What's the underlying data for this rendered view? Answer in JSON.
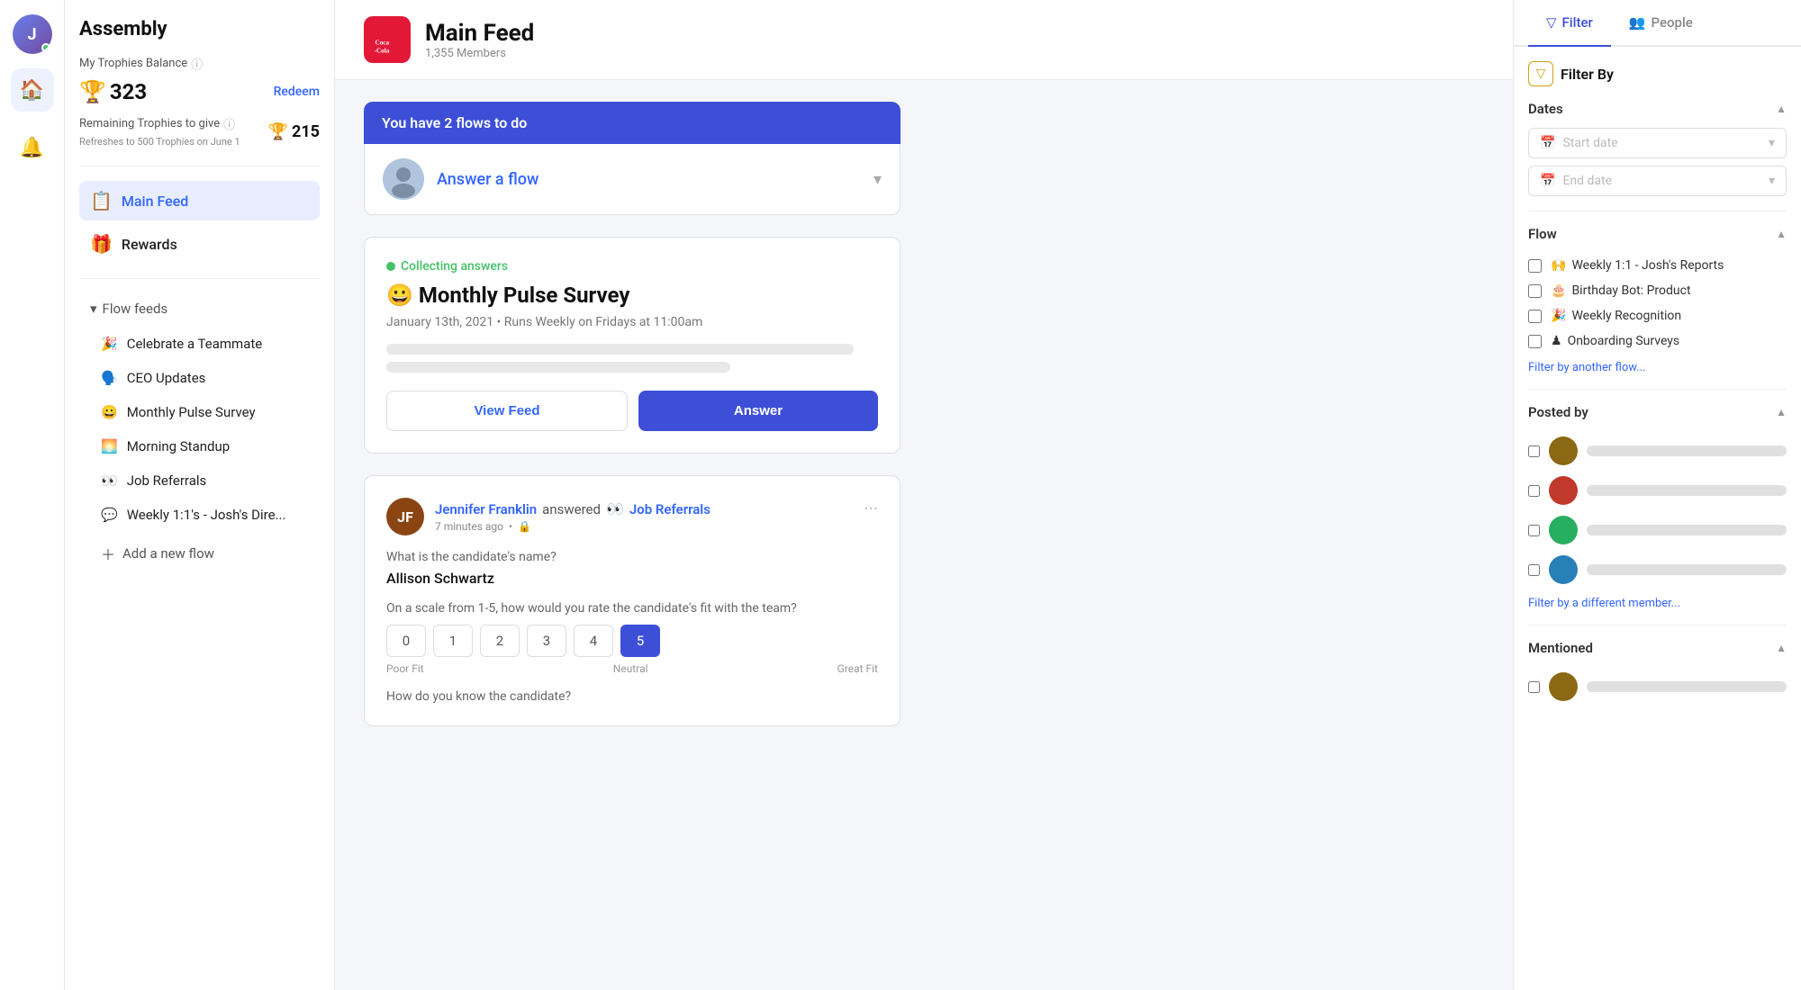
{
  "iconBar": {
    "userInitial": "J"
  },
  "sidebar": {
    "companyName": "Assembly",
    "trophiesSection": {
      "myTrophiesLabel": "My Trophies Balance",
      "infoIcon": "ℹ",
      "balance": "323",
      "redeemLabel": "Redeem",
      "remainingLabel": "Remaining Trophies to give",
      "remainingAmount": "215",
      "refreshesText": "Refreshes to 500 Trophies on June 1"
    },
    "navItems": [
      {
        "id": "main-feed",
        "emoji": "📋",
        "label": "Main Feed",
        "active": true
      },
      {
        "id": "rewards",
        "emoji": "🎁",
        "label": "Rewards",
        "active": false
      }
    ],
    "flowFeeds": {
      "header": "Flow feeds",
      "items": [
        {
          "id": "celebrate",
          "emoji": "🎉",
          "label": "Celebrate a Teammate"
        },
        {
          "id": "ceo",
          "emoji": "🗣",
          "label": "CEO Updates"
        },
        {
          "id": "monthly-pulse",
          "emoji": "😀",
          "label": "Monthly Pulse Survey"
        },
        {
          "id": "morning-standup",
          "emoji": "🌅",
          "label": "Morning Standup"
        },
        {
          "id": "job-referrals",
          "emoji": "👀",
          "label": "Job Referrals"
        },
        {
          "id": "weekly-1on1",
          "emoji": "💬",
          "label": "Weekly 1:1's - Josh's Dire..."
        }
      ],
      "addFlowLabel": "Add a new flow"
    }
  },
  "mainHeader": {
    "logoText": "Coca-Cola",
    "title": "Main Feed",
    "subtitle": "1,355 Members"
  },
  "flowsBanner": {
    "text": "You have 2 flows to do"
  },
  "flowAnswerCard": {
    "text": "Answer a flow"
  },
  "surveyCard": {
    "collectingText": "Collecting answers",
    "title": "😀 Monthly Pulse Survey",
    "dateText": "January 13th, 2021 • Runs Weekly on Fridays at 11:00am",
    "viewFeedLabel": "View Feed",
    "answerLabel": "Answer"
  },
  "postCard": {
    "authorName": "Jennifer Franklin",
    "actionText": "answered",
    "eyeEmoji": "👀",
    "flowName": "Job Referrals",
    "timeAgo": "7 minutes ago",
    "visibilityIcon": "🔒",
    "question1": "What is the candidate's name?",
    "answer1": "Allison Schwartz",
    "question2": "On a scale from 1-5, how would you rate the candidate's fit with the team?",
    "ratings": [
      "0",
      "1",
      "2",
      "3",
      "4",
      "5"
    ],
    "selectedRating": "5",
    "ratingLabelLeft": "Poor Fit",
    "ratingLabelMid": "Neutral",
    "ratingLabelRight": "Great Fit",
    "question3": "How do you know the candidate?"
  },
  "rightPanel": {
    "tabs": [
      {
        "id": "filter",
        "label": "Filter",
        "active": true,
        "icon": "🔽"
      },
      {
        "id": "people",
        "label": "People",
        "active": false,
        "icon": "👥"
      }
    ],
    "filterByLabel": "Filter By",
    "sections": {
      "dates": {
        "label": "Dates",
        "startDatePlaceholder": "Start date",
        "endDatePlaceholder": "End date"
      },
      "flow": {
        "label": "Flow",
        "items": [
          {
            "emoji": "🙌",
            "label": "Weekly 1:1 - Josh's Reports"
          },
          {
            "emoji": "🎂",
            "label": "Birthday Bot: Product"
          },
          {
            "emoji": "🎉",
            "label": "Weekly Recognition"
          },
          {
            "emoji": "♟",
            "label": "Onboarding Surveys"
          }
        ],
        "moreLink": "Filter by another flow..."
      },
      "postedBy": {
        "label": "Posted by",
        "members": [
          {
            "id": "member1",
            "color": "#8B6914"
          },
          {
            "id": "member2",
            "color": "#c0392b"
          },
          {
            "id": "member3",
            "color": "#27ae60"
          },
          {
            "id": "member4",
            "color": "#2980b9"
          }
        ],
        "moreLink": "Filter by a different member..."
      },
      "mentioned": {
        "label": "Mentioned",
        "members": [
          {
            "id": "mentioned1",
            "color": "#8B6914"
          }
        ]
      }
    }
  }
}
